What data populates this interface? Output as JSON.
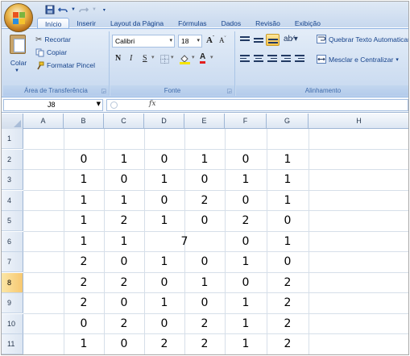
{
  "tabs": [
    "Início",
    "Inserir",
    "Layout da Página",
    "Fórmulas",
    "Dados",
    "Revisão",
    "Exibição"
  ],
  "clipboard": {
    "paste_label": "Colar",
    "cut_label": "Recortar",
    "copy_label": "Copiar",
    "format_painter_label": "Formatar Pincel",
    "group_label": "Área de Transferência"
  },
  "font": {
    "name": "Calibri",
    "size": "18",
    "group_label": "Fonte",
    "bold": "N",
    "italic": "I",
    "underline": "S"
  },
  "alignment": {
    "wrap_text_label": "Quebrar Texto Automaticamente",
    "merge_center_label": "Mesclar e Centralizar",
    "group_label": "Alinhamento"
  },
  "formula_bar": {
    "name_box": "J8",
    "fx": "fx",
    "content": ""
  },
  "columns": [
    "A",
    "B",
    "C",
    "D",
    "E",
    "F",
    "G",
    "H"
  ],
  "rows": [
    {
      "num": "1",
      "cells": [
        "",
        "",
        "",
        "",
        "",
        "",
        ""
      ]
    },
    {
      "num": "2",
      "cells": [
        "",
        "0",
        "1",
        "0",
        "1",
        "0",
        "1"
      ]
    },
    {
      "num": "3",
      "cells": [
        "",
        "1",
        "0",
        "1",
        "0",
        "1",
        "1"
      ]
    },
    {
      "num": "4",
      "cells": [
        "",
        "1",
        "1",
        "0",
        "2",
        "0",
        "1"
      ]
    },
    {
      "num": "5",
      "cells": [
        "",
        "1",
        "2",
        "1",
        "0",
        "2",
        "0"
      ]
    },
    {
      "num": "6",
      "cells": [
        "",
        "1",
        "1",
        "7",
        "",
        "0",
        "1"
      ]
    },
    {
      "num": "7",
      "cells": [
        "",
        "2",
        "0",
        "1",
        "0",
        "1",
        "0"
      ]
    },
    {
      "num": "8",
      "cells": [
        "",
        "2",
        "2",
        "0",
        "1",
        "0",
        "2"
      ]
    },
    {
      "num": "9",
      "cells": [
        "",
        "2",
        "0",
        "1",
        "0",
        "1",
        "2"
      ]
    },
    {
      "num": "10",
      "cells": [
        "",
        "0",
        "2",
        "0",
        "2",
        "1",
        "2"
      ]
    },
    {
      "num": "11",
      "cells": [
        "",
        "1",
        "0",
        "2",
        "2",
        "1",
        "2"
      ]
    }
  ],
  "selected_row": "8",
  "colors": {
    "ribbon": "#dbe6f4",
    "accent": "#15428b",
    "selected_header": "#f7c871"
  }
}
